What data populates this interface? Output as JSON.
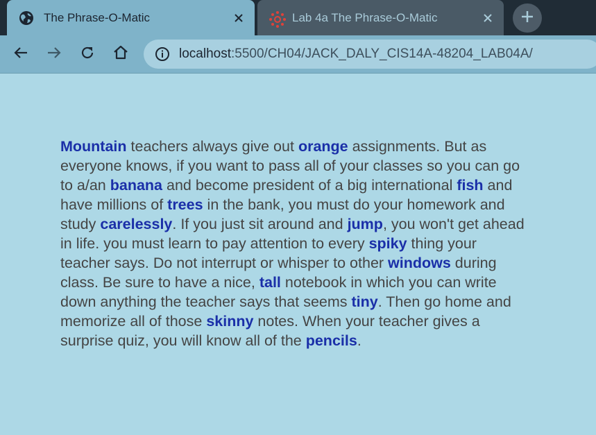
{
  "browser": {
    "tabs": [
      {
        "title": "The Phrase-O-Matic",
        "icon": "globe-icon",
        "active": true
      },
      {
        "title": "Lab 4a The Phrase-O-Matic",
        "icon": "canvas-logo-icon",
        "active": false
      }
    ],
    "address": {
      "host": "localhost",
      "path": ":5500/CH04/JACK_DALY_CIS14A-48204_LAB04A/"
    }
  },
  "colors": {
    "page_background": "#add8e6",
    "body_text": "#444444",
    "highlight_word": "#1a2fa8",
    "tab_strip": "#202c36",
    "toolbar": "#7fb3c9"
  },
  "phrase": {
    "w1": "Mountain",
    "t1": " teachers always give out ",
    "w2": "orange",
    "t2": " assignments. But as everyone knows, if you want to pass all of your classes so you can go to a/an ",
    "w3": "banana",
    "t3": " and become president of a big international ",
    "w4": "fish",
    "t4": " and have millions of ",
    "w5": "trees",
    "t5": " in the bank, you must do your homework and study ",
    "w6": "carelessly",
    "t6": ". If you just sit around and ",
    "w7": "jump",
    "t7": ", you won't get ahead in life. you must learn to pay attention to every ",
    "w8": "spiky",
    "t8": " thing your teacher says. Do not interrupt or whisper to other ",
    "w9": "windows",
    "t9": " during class. Be sure to have a nice, ",
    "w10": "tall",
    "t10": " notebook in which you can write down anything the teacher says that seems ",
    "w11": "tiny",
    "t11": ". Then go home and memorize all of those ",
    "w12": "skinny",
    "t12": " notes. When your teacher gives a surprise quiz, you will know all of the ",
    "w13": "pencils",
    "t13": "."
  }
}
